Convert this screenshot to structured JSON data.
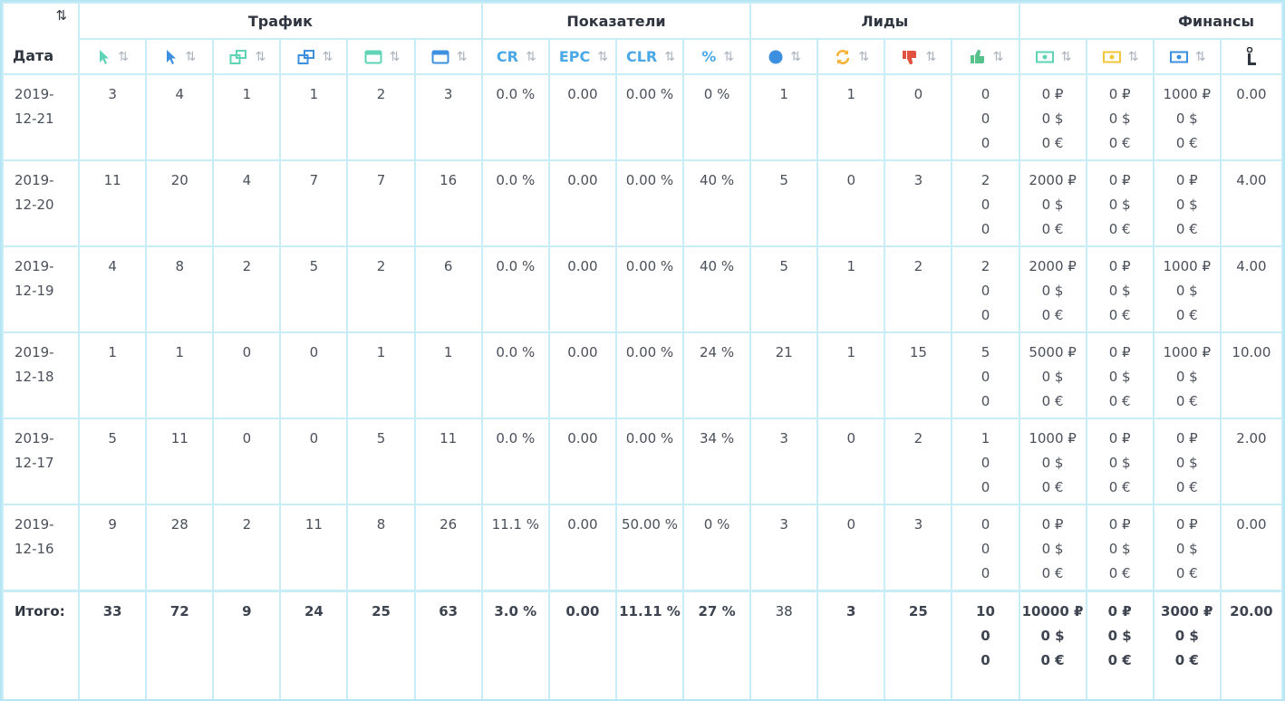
{
  "groups": {
    "traffic": "Трафик",
    "metrics": "Показатели",
    "leads": "Лиды",
    "finance": "Финансы"
  },
  "date_header": "Дата",
  "sort_glyph": "⇅",
  "metric_labels": {
    "cr": "CR",
    "epc": "EPC",
    "clr": "CLR",
    "pct": "%"
  },
  "icon_colors": {
    "teal": "#5fd3b5",
    "blue": "#3d8fe0",
    "orange": "#f5b234",
    "red": "#e0523f",
    "green": "#55c28a",
    "yellow": "#f0c63a"
  },
  "rows": [
    {
      "date": [
        "2019-",
        "12-21"
      ],
      "t1": "3",
      "t2": "4",
      "t3": "1",
      "t4": "1",
      "t5": "2",
      "t6": "3",
      "cr": "0.0 %",
      "epc": "0.00",
      "clr": "0.00 %",
      "pct": "0 %",
      "l1": "1",
      "l2": "1",
      "l3": "0",
      "l4": [
        "0",
        "0",
        "0"
      ],
      "f1": [
        "0 ₽",
        "0 $",
        "0 €"
      ],
      "f2": [
        "0 ₽",
        "0 $",
        "0 €"
      ],
      "f3": [
        "1000 ₽",
        "0 $",
        "0 €"
      ],
      "f4": "0.00"
    },
    {
      "date": [
        "2019-",
        "12-20"
      ],
      "t1": "11",
      "t2": "20",
      "t3": "4",
      "t4": "7",
      "t5": "7",
      "t6": "16",
      "cr": "0.0 %",
      "epc": "0.00",
      "clr": "0.00 %",
      "pct": "40 %",
      "l1": "5",
      "l2": "0",
      "l3": "3",
      "l4": [
        "2",
        "0",
        "0"
      ],
      "f1": [
        "2000 ₽",
        "0 $",
        "0 €"
      ],
      "f2": [
        "0 ₽",
        "0 $",
        "0 €"
      ],
      "f3": [
        "0 ₽",
        "0 $",
        "0 €"
      ],
      "f4": "4.00"
    },
    {
      "date": [
        "2019-",
        "12-19"
      ],
      "t1": "4",
      "t2": "8",
      "t3": "2",
      "t4": "5",
      "t5": "2",
      "t6": "6",
      "cr": "0.0 %",
      "epc": "0.00",
      "clr": "0.00 %",
      "pct": "40 %",
      "l1": "5",
      "l2": "1",
      "l3": "2",
      "l4": [
        "2",
        "0",
        "0"
      ],
      "f1": [
        "2000 ₽",
        "0 $",
        "0 €"
      ],
      "f2": [
        "0 ₽",
        "0 $",
        "0 €"
      ],
      "f3": [
        "1000 ₽",
        "0 $",
        "0 €"
      ],
      "f4": "4.00"
    },
    {
      "date": [
        "2019-",
        "12-18"
      ],
      "t1": "1",
      "t2": "1",
      "t3": "0",
      "t4": "0",
      "t5": "1",
      "t6": "1",
      "cr": "0.0 %",
      "epc": "0.00",
      "clr": "0.00 %",
      "pct": "24 %",
      "l1": "21",
      "l2": "1",
      "l3": "15",
      "l4": [
        "5",
        "0",
        "0"
      ],
      "f1": [
        "5000 ₽",
        "0 $",
        "0 €"
      ],
      "f2": [
        "0 ₽",
        "0 $",
        "0 €"
      ],
      "f3": [
        "1000 ₽",
        "0 $",
        "0 €"
      ],
      "f4": "10.00"
    },
    {
      "date": [
        "2019-",
        "12-17"
      ],
      "t1": "5",
      "t2": "11",
      "t3": "0",
      "t4": "0",
      "t5": "5",
      "t6": "11",
      "cr": "0.0 %",
      "epc": "0.00",
      "clr": "0.00 %",
      "pct": "34 %",
      "l1": "3",
      "l2": "0",
      "l3": "2",
      "l4": [
        "1",
        "0",
        "0"
      ],
      "f1": [
        "1000 ₽",
        "0 $",
        "0 €"
      ],
      "f2": [
        "0 ₽",
        "0 $",
        "0 €"
      ],
      "f3": [
        "0 ₽",
        "0 $",
        "0 €"
      ],
      "f4": "2.00"
    },
    {
      "date": [
        "2019-",
        "12-16"
      ],
      "t1": "9",
      "t2": "28",
      "t3": "2",
      "t4": "11",
      "t5": "8",
      "t6": "26",
      "cr": "11.1 %",
      "epc": "0.00",
      "clr": "50.00 %",
      "pct": "0 %",
      "l1": "3",
      "l2": "0",
      "l3": "3",
      "l4": [
        "0",
        "0",
        "0"
      ],
      "f1": [
        "0 ₽",
        "0 $",
        "0 €"
      ],
      "f2": [
        "0 ₽",
        "0 $",
        "0 €"
      ],
      "f3": [
        "0 ₽",
        "0 $",
        "0 €"
      ],
      "f4": "0.00"
    }
  ],
  "total": {
    "label": "Итого:",
    "t1": "33",
    "t2": "72",
    "t3": "9",
    "t4": "24",
    "t5": "25",
    "t6": "63",
    "cr": "3.0 %",
    "epc": "0.00",
    "clr": "11.11 %",
    "pct": "27 %",
    "l1": "38",
    "l2": "3",
    "l3": "25",
    "l4": [
      "10",
      "0",
      "0"
    ],
    "f1": [
      "10000 ₽",
      "0 $",
      "0 €"
    ],
    "f2": [
      "0 ₽",
      "0 $",
      "0 €"
    ],
    "f3": [
      "3000 ₽",
      "0 $",
      "0 €"
    ],
    "f4": "20.00"
  }
}
